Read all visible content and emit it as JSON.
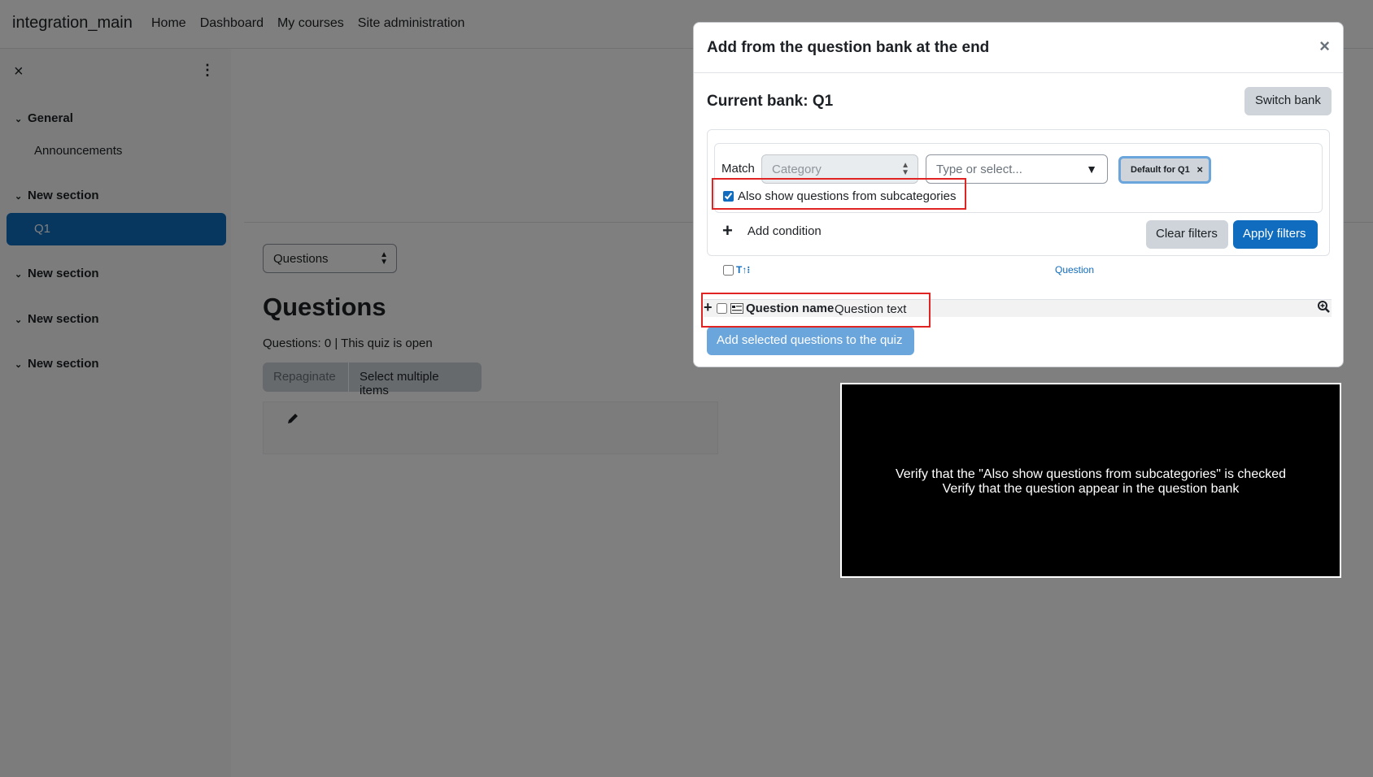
{
  "navbar": {
    "site_name": "integration_main",
    "links": [
      "Home",
      "Dashboard",
      "My courses",
      "Site administration"
    ]
  },
  "drawer": {
    "close_icon": "×",
    "menu_icon": "⋮",
    "sections": [
      {
        "label": "General"
      },
      {
        "label": "New section"
      },
      {
        "label": "New section"
      },
      {
        "label": "New section"
      },
      {
        "label": "New section"
      }
    ],
    "announcements": "Announcements",
    "active_item": "Q1"
  },
  "main": {
    "select_value": "Questions",
    "title": "Questions",
    "info": "Questions: 0 | This quiz is open",
    "repaginate": "Repaginate",
    "select_multiple": "Select multiple items"
  },
  "modal": {
    "title": "Add from the question bank at the end",
    "close": "×",
    "bank_title": "Current bank: Q1",
    "switch_bank": "Switch bank",
    "filter": {
      "match": "Match",
      "category_placeholder": "Category",
      "type_placeholder": "Type or select...",
      "tag": "Default for Q1",
      "tag_remove": "×",
      "subcategories_label": "Also show questions from subcategories",
      "subcategories_checked": true,
      "add_condition": "Add condition",
      "clear_filters": "Clear filters",
      "apply_filters": "Apply filters"
    },
    "table": {
      "sort_label": "T",
      "question_column": "Question",
      "row": {
        "name": "Question name",
        "text": "Question text"
      }
    },
    "add_selected": "Add selected questions to the quiz"
  },
  "caption": {
    "line1": "Verify that the \"Also show questions from subcategories\" is checked",
    "line2": "Verify that the question appear in the question bank"
  },
  "colors": {
    "primary": "#0f6cbf",
    "secondary": "#ced4da",
    "highlight": "#e02424"
  }
}
